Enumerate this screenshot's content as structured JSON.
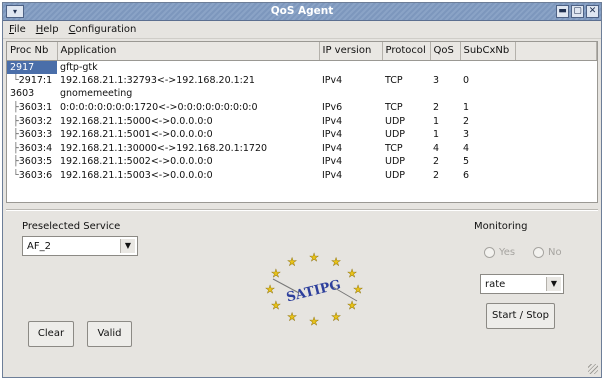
{
  "window": {
    "title": "QoS Agent",
    "sysmenu_glyph": "▾",
    "btn_min": "▬",
    "btn_max": "▢",
    "btn_close": "✕"
  },
  "menu": [
    "File",
    "Help",
    "Configuration"
  ],
  "table": {
    "headers": [
      "Proc Nb",
      "Application",
      "IP version",
      "Protocol",
      "QoS",
      "SubCxNb"
    ],
    "rows": [
      {
        "proc": "2917",
        "app": "gftp-gtk",
        "ip": "",
        "protocol": "",
        "qos": "",
        "sub": "",
        "tree": "",
        "selected": true
      },
      {
        "proc": "2917:1",
        "app": "192.168.21.1:32793<->192.168.20.1:21",
        "ip": "IPv4",
        "protocol": "TCP",
        "qos": "3",
        "sub": "0",
        "tree": "└",
        "selected": false
      },
      {
        "proc": "3603",
        "app": "gnomemeeting",
        "ip": "",
        "protocol": "",
        "qos": "",
        "sub": "",
        "tree": "",
        "selected": false
      },
      {
        "proc": "3603:1",
        "app": "0:0:0:0:0:0:0:0:1720<->0:0:0:0:0:0:0:0:0",
        "ip": "IPv6",
        "protocol": "TCP",
        "qos": "2",
        "sub": "1",
        "tree": "├",
        "selected": false
      },
      {
        "proc": "3603:2",
        "app": "192.168.21.1:5000<->0.0.0.0:0",
        "ip": "IPv4",
        "protocol": "UDP",
        "qos": "1",
        "sub": "2",
        "tree": "├",
        "selected": false
      },
      {
        "proc": "3603:3",
        "app": "192.168.21.1:5001<->0.0.0.0:0",
        "ip": "IPv4",
        "protocol": "UDP",
        "qos": "1",
        "sub": "3",
        "tree": "├",
        "selected": false
      },
      {
        "proc": "3603:4",
        "app": "192.168.21.1:30000<->192.168.20.1:1720",
        "ip": "IPv4",
        "protocol": "TCP",
        "qos": "4",
        "sub": "4",
        "tree": "├",
        "selected": false
      },
      {
        "proc": "3603:5",
        "app": "192.168.21.1:5002<->0.0.0.0:0",
        "ip": "IPv4",
        "protocol": "UDP",
        "qos": "2",
        "sub": "5",
        "tree": "├",
        "selected": false
      },
      {
        "proc": "3603:6",
        "app": "192.168.21.1:5003<->0.0.0.0:0",
        "ip": "IPv4",
        "protocol": "UDP",
        "qos": "2",
        "sub": "6",
        "tree": "└",
        "selected": false
      }
    ]
  },
  "preselected": {
    "label": "Preselected Service",
    "value": "AF_2",
    "clear_label": "Clear",
    "valid_label": "Valid"
  },
  "monitoring": {
    "label": "Monitoring",
    "radio_yes": "Yes",
    "radio_no": "No",
    "metric": "rate",
    "start_stop_label": "Start / Stop"
  },
  "logo": {
    "text": "SATIPG",
    "star_color": "#e8c21a",
    "text_color": "#2d3f9c"
  },
  "colors": {
    "titlebar": "#8aa3c6",
    "selection": "#4a6ea9"
  }
}
